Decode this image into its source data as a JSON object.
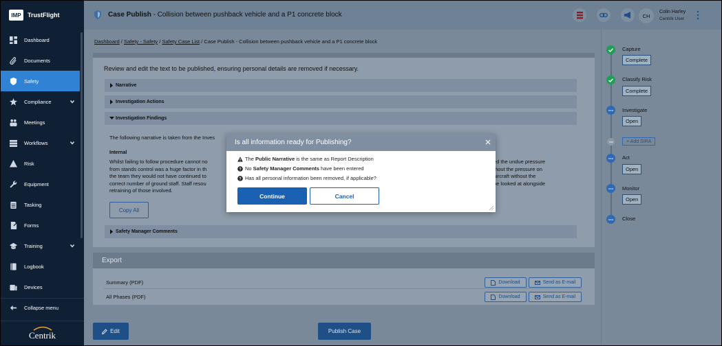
{
  "brand": {
    "logo_text": "IMP",
    "name": "TrustFlight",
    "footer": "Centrik"
  },
  "sidebar": {
    "items": [
      {
        "label": "Dashboard",
        "icon": "dashboard-icon"
      },
      {
        "label": "Documents",
        "icon": "paperclip-icon"
      },
      {
        "label": "Safety",
        "icon": "shield-icon",
        "active": true
      },
      {
        "label": "Compliance",
        "icon": "star-icon",
        "has_children": true
      },
      {
        "label": "Meetings",
        "icon": "people-icon"
      },
      {
        "label": "Workflows",
        "icon": "stack-icon",
        "has_children": true
      },
      {
        "label": "Risk",
        "icon": "warning-icon"
      },
      {
        "label": "Equipment",
        "icon": "wrench-icon"
      },
      {
        "label": "Tasking",
        "icon": "clipboard-icon"
      },
      {
        "label": "Forms",
        "icon": "forms-icon"
      },
      {
        "label": "Training",
        "icon": "graduation-cap-icon",
        "has_children": true
      },
      {
        "label": "Logbook",
        "icon": "book-icon"
      },
      {
        "label": "Devices",
        "icon": "device-icon"
      }
    ],
    "collapse_label": "Collapse menu"
  },
  "topbar": {
    "title_bold": "Case Publish",
    "title_rest": " - Collision between pushback vehicle and a P1 concrete block",
    "user_initials": "CH",
    "user_name": "Colin Harley",
    "user_role": "Centrik User"
  },
  "breadcrumb": {
    "items": [
      "Dashboard",
      "Safety - Safety",
      "Safety Case List"
    ],
    "current": "Case Publish - Collision between pushback vehicle and a P1 concrete block"
  },
  "card": {
    "intro": "Review and edit the text to be published, ensuring personal details are removed if necessary.",
    "sections": [
      "Narrative",
      "Investigation Actions",
      "Investigation Findings",
      "Safety Manager Comments"
    ],
    "findings_intro": "The following narrative is taken from the Inves",
    "internal_label": "Internal",
    "body_left": [
      "Whilst failing to follow procedure cannot no",
      "from stands control was a huge factor in th",
      "the team they would not have continued to",
      "correct number of ground staff. Staff resou",
      "retraining of those involved."
    ],
    "body_right": [
      "ed the undue pressure",
      "thout the pressure on",
      " aircraft without the",
      " be looked at alongside"
    ],
    "copy_all": "Copy All"
  },
  "export": {
    "title": "Export",
    "rows": [
      {
        "label": "Summary (PDF)",
        "download": "Download",
        "email": "Send as E-mail"
      },
      {
        "label": "All Phases (PDF)",
        "download": "Download",
        "email": "Send as E-mail"
      }
    ]
  },
  "actions": {
    "edit": "Edit",
    "publish": "Publish Case"
  },
  "workflow": {
    "steps": [
      {
        "label": "Capture",
        "button": "Complete",
        "state": "done"
      },
      {
        "label": "Classify Risk",
        "button": "Complete",
        "state": "done"
      },
      {
        "label": "Investigate",
        "button": "Open",
        "state": "todo"
      },
      {
        "label": "Act",
        "button": "Open",
        "state": "todo"
      },
      {
        "label": "Monitor",
        "button": "Open",
        "state": "todo"
      },
      {
        "label": "Close",
        "button": "",
        "state": "todo"
      }
    ],
    "sira": "+ Add SIRA"
  },
  "modal": {
    "title": "Is all information ready for Publishing?",
    "line1_pre": "The ",
    "line1_bold": "Public Narrative",
    "line1_post": " is the same as Report Description",
    "line2_pre": "No ",
    "line2_bold": "Safety Manager Comments",
    "line2_post": " have been entered",
    "line3": "Has all personal information been removed, if applicable?",
    "continue": "Continue",
    "cancel": "Cancel"
  },
  "colors": {
    "sidebar_bg": "#0f2035",
    "active": "#2f82d4",
    "primary": "#1b61b3",
    "done": "#1f9e55",
    "overlay": "#7a899a"
  }
}
